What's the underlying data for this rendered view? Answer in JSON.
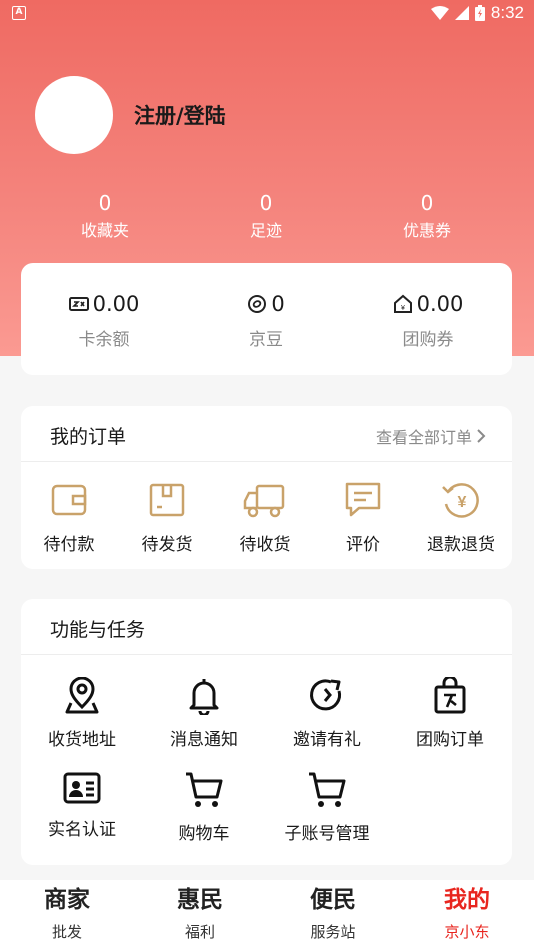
{
  "status_bar": {
    "time": "8:32",
    "left_badge": "A"
  },
  "profile": {
    "login_label": "注册/登陆"
  },
  "stats": [
    {
      "value": "0",
      "label": "收藏夹"
    },
    {
      "value": "0",
      "label": "足迹"
    },
    {
      "value": "0",
      "label": "优惠券"
    }
  ],
  "wallet": [
    {
      "icon": "card-icon",
      "value": "0.00",
      "label": "卡余额"
    },
    {
      "icon": "bean-icon",
      "value": "0",
      "label": "京豆"
    },
    {
      "icon": "group-coupon-icon",
      "value": "0.00",
      "label": "团购券"
    }
  ],
  "orders": {
    "title": "我的订单",
    "view_all": "查看全部订单",
    "items": [
      {
        "icon": "wallet-icon",
        "label": "待付款"
      },
      {
        "icon": "package-icon",
        "label": "待发货"
      },
      {
        "icon": "truck-icon",
        "label": "待收货"
      },
      {
        "icon": "comment-icon",
        "label": "评价"
      },
      {
        "icon": "refund-icon",
        "label": "退款退货"
      }
    ]
  },
  "tasks": {
    "title": "功能与任务",
    "items": [
      {
        "icon": "location-icon",
        "label": "收货地址"
      },
      {
        "icon": "bell-icon",
        "label": "消息通知"
      },
      {
        "icon": "invite-icon",
        "label": "邀请有礼"
      },
      {
        "icon": "group-order-icon",
        "label": "团购订单"
      },
      {
        "icon": "id-card-icon",
        "label": "实名认证"
      },
      {
        "icon": "cart-icon",
        "label": "购物车"
      },
      {
        "icon": "cart-icon",
        "label": "子账号管理"
      }
    ]
  },
  "tabbar": [
    {
      "main": "商家",
      "sub": "批发"
    },
    {
      "main": "惠民",
      "sub": "福利"
    },
    {
      "main": "便民",
      "sub": "服务站"
    },
    {
      "main": "我的",
      "sub": "京小东",
      "active": true
    }
  ],
  "colors": {
    "accent": "#e8261f",
    "hero_top": "#ef6a62",
    "icon_gold": "#c9a26a"
  }
}
